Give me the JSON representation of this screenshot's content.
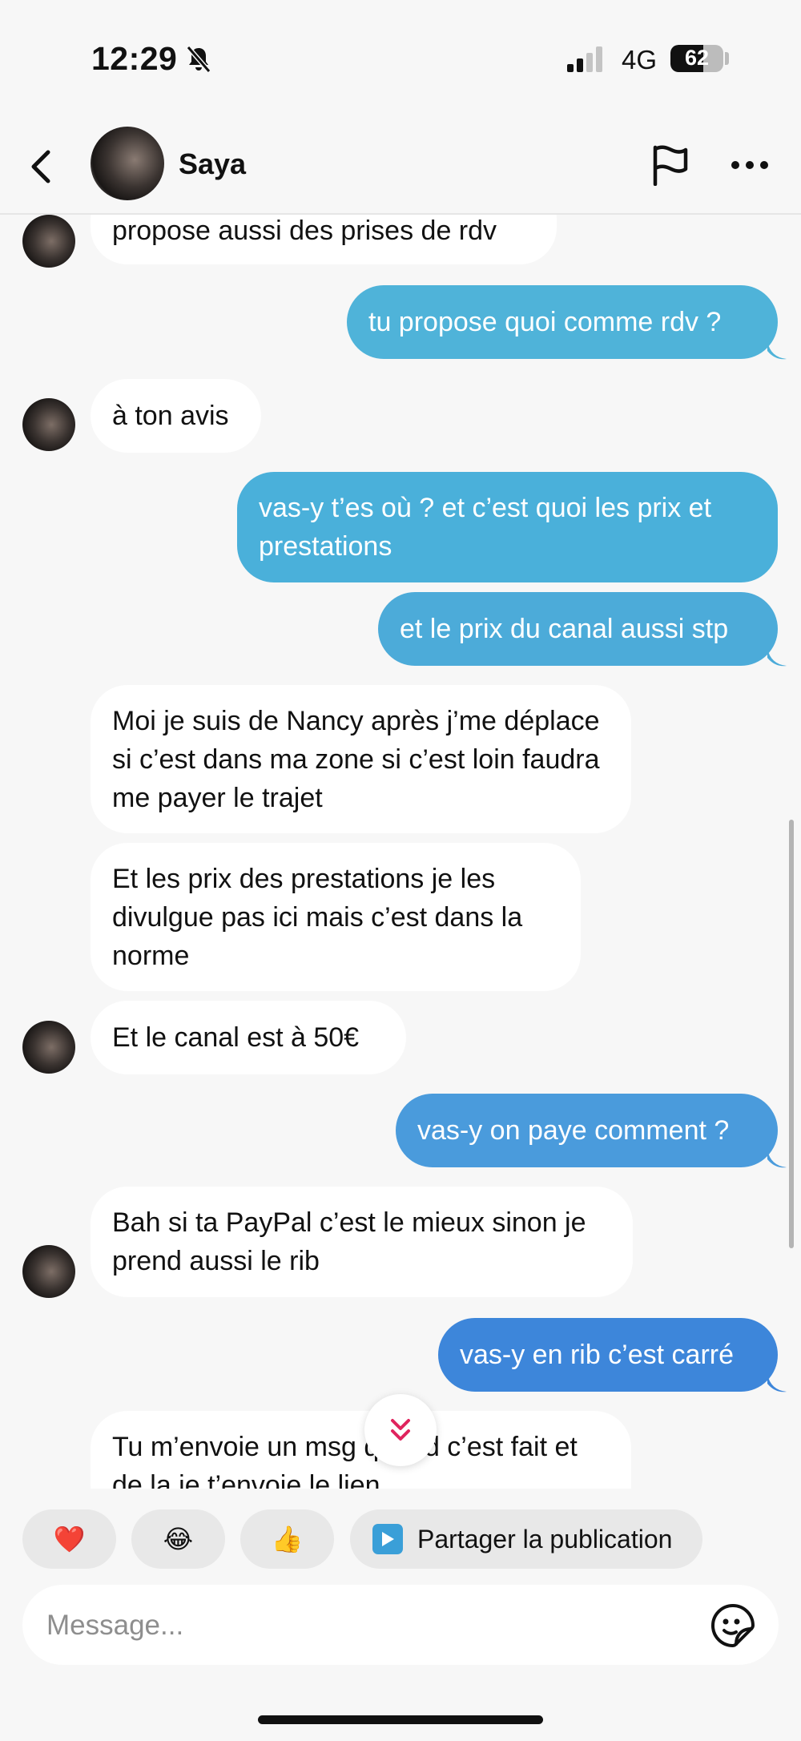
{
  "status_bar": {
    "time": "12:29",
    "network": "4G",
    "battery": "62",
    "battery_level": 0.62
  },
  "header": {
    "contact_name": "Saya",
    "icons": [
      "back-icon",
      "flag-icon",
      "more-icon"
    ]
  },
  "colors": {
    "outgoing_light": "#4fb3d9",
    "outgoing_mid": "#4a9bdc",
    "outgoing_dark": "#3d86da",
    "incoming": "#ffffff"
  },
  "messages": [
    {
      "direction": "in",
      "text": "propose aussi des prises de rdv"
    },
    {
      "direction": "out",
      "text": "tu propose quoi comme rdv ?"
    },
    {
      "direction": "in",
      "text": "à ton avis"
    },
    {
      "direction": "out",
      "text": "vas-y t’es où ? et c’est quoi les prix et prestations"
    },
    {
      "direction": "out",
      "text": "et le prix du canal aussi stp"
    },
    {
      "direction": "in",
      "text": "Moi je suis de Nancy après j’me déplace si c’est dans ma zone si c’est loin faudra me payer le trajet"
    },
    {
      "direction": "in",
      "text": "Et les prix des prestations je les divulgue pas ici mais c’est dans la norme"
    },
    {
      "direction": "in",
      "text": "Et le canal est à 50€"
    },
    {
      "direction": "out",
      "text": "vas-y on paye comment ?"
    },
    {
      "direction": "in",
      "text": "Bah si ta PayPal c’est le mieux sinon je prend aussi le rib"
    },
    {
      "direction": "out",
      "text": "vas-y en rib c’est carré"
    },
    {
      "direction": "in",
      "text": "Tu m’envoie un msg quand c’est fait et de la je t’envoie le lien"
    }
  ],
  "quick_replies": {
    "heart": "❤️",
    "laugh": "😂",
    "thumbs_up": "👍",
    "share_label": "Partager la publication"
  },
  "composer": {
    "placeholder": "Message..."
  }
}
